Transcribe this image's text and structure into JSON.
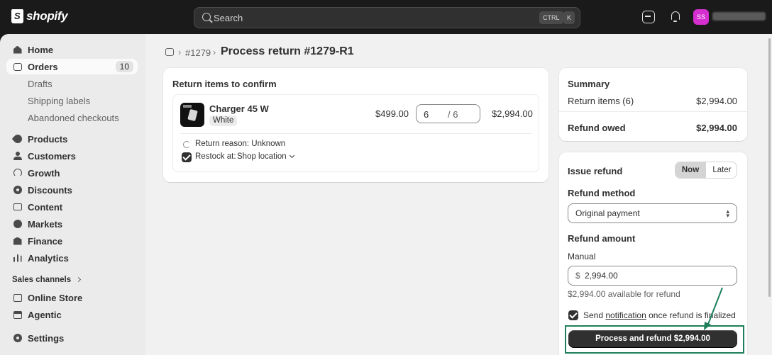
{
  "topbar": {
    "logo_text": "shopify",
    "search_placeholder": "Search",
    "shortcut_ctrl": "CTRL",
    "shortcut_k": "K",
    "avatar_initials": "SS"
  },
  "sidebar": {
    "items": [
      {
        "label": "Home",
        "icon": "home-icon"
      },
      {
        "label": "Orders",
        "icon": "orders-icon",
        "badge": "10"
      },
      {
        "label": "Drafts"
      },
      {
        "label": "Shipping labels"
      },
      {
        "label": "Abandoned checkouts"
      },
      {
        "label": "Products",
        "icon": "tag-icon"
      },
      {
        "label": "Customers",
        "icon": "person-icon"
      },
      {
        "label": "Growth",
        "icon": "gauge-icon"
      },
      {
        "label": "Discounts",
        "icon": "discount-icon"
      },
      {
        "label": "Content",
        "icon": "monitor-icon"
      },
      {
        "label": "Markets",
        "icon": "globe-icon"
      },
      {
        "label": "Finance",
        "icon": "bank-icon"
      },
      {
        "label": "Analytics",
        "icon": "bar-chart-icon"
      },
      {
        "label": "Online Store",
        "icon": "store-icon"
      },
      {
        "label": "Agentic",
        "icon": "agent-icon"
      },
      {
        "label": "Settings",
        "icon": "gear-icon"
      }
    ],
    "sales_channels_label": "Sales channels"
  },
  "breadcrumb": {
    "order_link": "#1279",
    "separator": "›",
    "title": "Process return #1279-R1"
  },
  "return_items": {
    "title": "Return items to confirm",
    "item": {
      "name": "Charger 45 W",
      "variant": "White",
      "price": "$499.00",
      "quantity": "6",
      "max_quantity": "/ 6",
      "total": "$2,994.00",
      "return_reason": "Return reason: Unknown",
      "restock_label": "Restock at:",
      "restock_location": "Shop location"
    }
  },
  "summary": {
    "title": "Summary",
    "return_items_label": "Return items (6)",
    "return_items_value": "$2,994.00",
    "refund_owed_label": "Refund owed",
    "refund_owed_value": "$2,994.00"
  },
  "refund": {
    "issue_label": "Issue refund",
    "now_label": "Now",
    "later_label": "Later",
    "method_label": "Refund method",
    "method_value": "Original payment",
    "amount_label": "Refund amount",
    "manual_label": "Manual",
    "currency": "$",
    "amount_value": "2,994.00",
    "available_text": "$2,994.00 available for refund",
    "notify_pre": "Send",
    "notify_link": "notification",
    "notify_post": "once refund is finalized",
    "submit_label": "Process and refund $2,994.00"
  },
  "colors": {
    "topbar": "#1a1a1a",
    "avatar": "#d52fd0",
    "primary_button": "#303030",
    "highlight": "#1e7f5a"
  }
}
